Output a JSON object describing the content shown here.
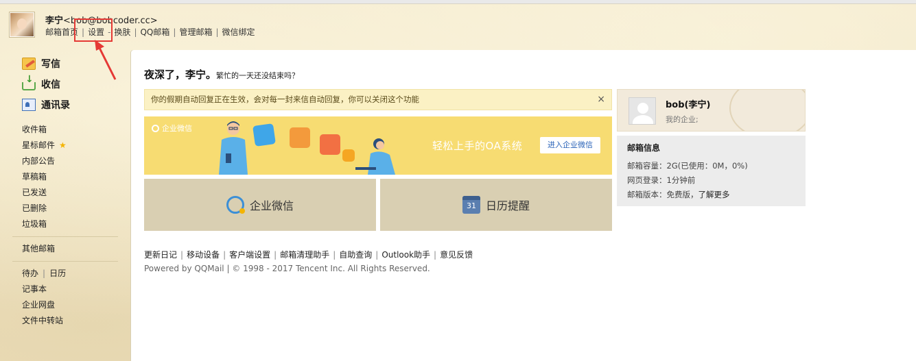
{
  "header": {
    "user_name": "李宁",
    "user_email": "<bob@bobcoder.cc>",
    "nav": [
      "邮箱首页",
      "设置",
      "换肤",
      "QQ邮箱",
      "管理邮箱",
      "微信绑定"
    ]
  },
  "sidebar": {
    "main_actions": [
      "写信",
      "收信",
      "通讯录"
    ],
    "folders": [
      "收件箱",
      "星标邮件",
      "内部公告",
      "草稿箱",
      "已发送",
      "已删除",
      "垃圾箱"
    ],
    "other": "其他邮箱",
    "tools_row": [
      "待办",
      "日历"
    ],
    "tools": [
      "记事本",
      "企业网盘",
      "文件中转站"
    ]
  },
  "main": {
    "greeting_big": "夜深了，李宁。",
    "greeting_small": "繁忙的一天还没结束吗？",
    "notice": "你的假期自动回复正在生效，会对每一封来信自动回复，你可以关闭这个功能",
    "notice_close": "×",
    "banner": {
      "brand": "企业微信",
      "slogan": "轻松上手的OA系统",
      "cta": "进入企业微信"
    },
    "tiles": [
      "企业微信",
      "日历提醒"
    ],
    "calendar_day": "31",
    "footer_links": [
      "更新日记",
      "移动设备",
      "客户端设置",
      "邮箱清理助手",
      "自助查询",
      "Outlook助手",
      "意见反馈"
    ],
    "copyright": "Powered by QQMail  | © 1998 - 2017 Tencent Inc. All Rights Reserved."
  },
  "profile": {
    "name": "bob(李宁)",
    "org": "我的企业;"
  },
  "mailbox_info": {
    "title": "邮箱信息",
    "capacity": "邮箱容量：2G(已使用：0M，0%)",
    "web_login": "网页登录：1分钟前",
    "version_prefix": "邮箱版本：免费版，",
    "version_link": "了解更多"
  },
  "colors": {
    "banner_bg": "#f7dc72",
    "tile_bg": "#d9cfb2",
    "notice_bg": "#fbf1c4",
    "annotation_red": "#e53935",
    "link_blue": "#2a63b8"
  }
}
